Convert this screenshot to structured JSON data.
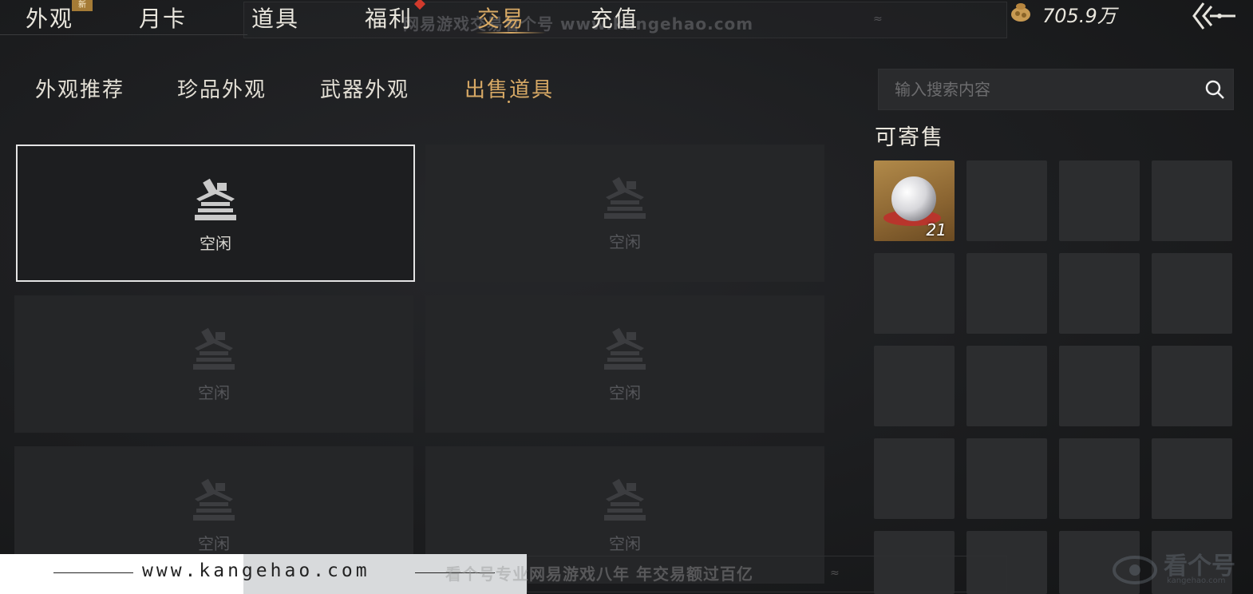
{
  "nav": {
    "items": [
      "外观",
      "月卡",
      "道具",
      "福利",
      "交易",
      "充值"
    ],
    "active": "交易",
    "new_badge": "新"
  },
  "watermark": {
    "top": "网易游戏交易看个号 www.kangehao.com",
    "url": "www.kangehao.com",
    "slogan": "看个号专业网易游戏八年  年交易额过百亿",
    "corner": "看个号",
    "corner_sub": "kangehao.com"
  },
  "currency": {
    "amount": "705.9万",
    "icon": "coin-pouch-icon"
  },
  "subtabs": {
    "items": [
      "外观推荐",
      "珍品外观",
      "武器外观",
      "出售道具"
    ],
    "active": "出售道具"
  },
  "search": {
    "placeholder": "输入搜索内容"
  },
  "slots": {
    "items": [
      "空闲",
      "空闲",
      "空闲",
      "空闲",
      "空闲",
      "空闲"
    ],
    "icon": "pavilion-icon"
  },
  "sellable": {
    "title": "可寄售",
    "first_item": {
      "icon": "pearl-icon",
      "count": "21"
    }
  },
  "colors": {
    "accent": "#d7a965",
    "background": "#1c1d1f",
    "badge": "#a57b36",
    "dot": "#d13a2c"
  }
}
